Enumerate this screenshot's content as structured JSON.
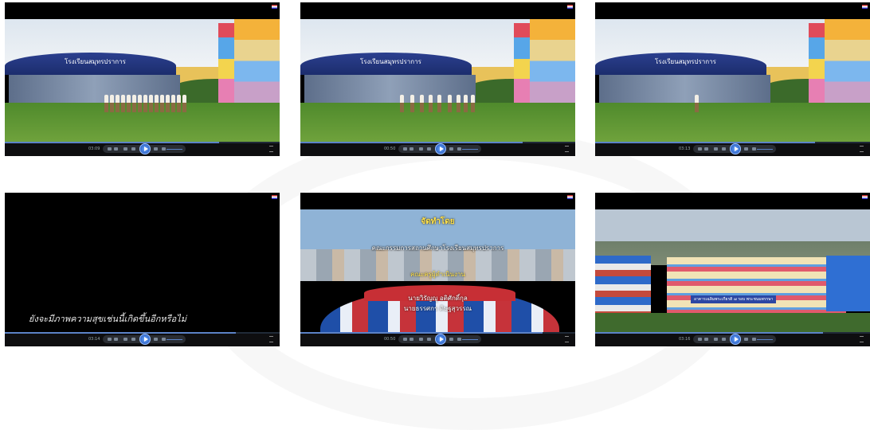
{
  "theme": {
    "seek_color": "#5b82c7",
    "play_color": "#2f6fe0",
    "player_bg": "#000000"
  },
  "players": [
    {
      "time": "03:09",
      "progress": 0.78,
      "scene": "school"
    },
    {
      "time": "00:50",
      "progress": 0.81,
      "scene": "school"
    },
    {
      "time": "03:13",
      "progress": 0.8,
      "scene": "school"
    },
    {
      "time": "03:14",
      "progress": 0.84,
      "scene": "quote",
      "quote_text": "ยังจะมีภาพความสุขเช่นนี้เกิดขึ้นอีกหรือไม่"
    },
    {
      "time": "00:50",
      "progress": 0.88,
      "scene": "credits",
      "credits": {
        "heading": "จัดทำโดย",
        "line1": "คณะกรรมการสถานศึกษาโรงเรียนสมุทรปราการ",
        "line2": "คณะครูผู้ดำเนินงาน",
        "name1": "นายวิรัญญู อติศักดิ์กุล",
        "name2": "นายธรรศกร ดิษฐสุวรรณ"
      }
    },
    {
      "time": "03:16",
      "progress": 0.83,
      "scene": "aerial",
      "sign_text": "อาคารเฉลิมพระเกียรติ ๗ รอบ พระชนมพรรษา"
    }
  ],
  "school_sign": "โรงเรียนสมุทรปราการ",
  "icons": [
    "shuffle-icon",
    "repeat-icon",
    "stop-icon",
    "previous-icon",
    "play-icon",
    "next-icon",
    "volume-icon",
    "menu-icon"
  ]
}
